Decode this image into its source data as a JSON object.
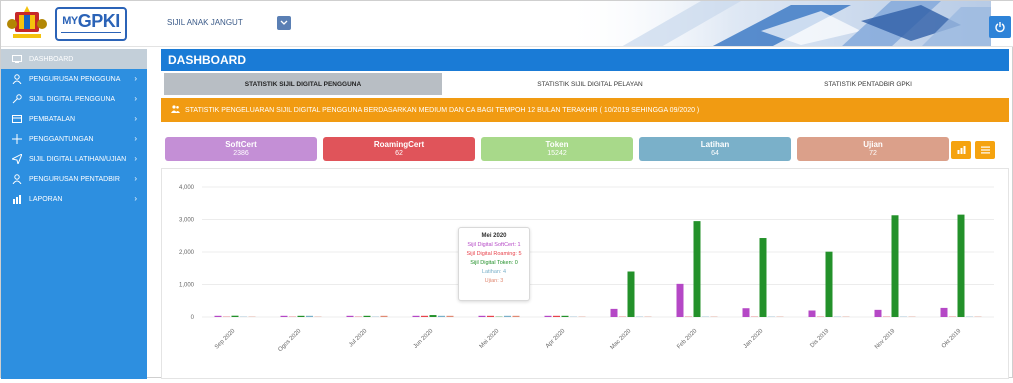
{
  "header": {
    "user_name": "SIJIL ANAK JANGUT",
    "logo_text_prefix": "MY",
    "logo_text_main": "GPKI",
    "dropdown_icon": "chevron-down-icon",
    "power_icon": "power-icon"
  },
  "sidebar": {
    "items": [
      {
        "label": "DASHBOARD",
        "icon": "monitor-icon",
        "active": true,
        "arrow": false
      },
      {
        "label": "PENGURUSAN PENGGUNA",
        "icon": "user-icon",
        "active": false,
        "arrow": true
      },
      {
        "label": "SIJIL DIGITAL PENGGUNA",
        "icon": "key-icon",
        "active": false,
        "arrow": true
      },
      {
        "label": "PEMBATALAN",
        "icon": "card-icon",
        "active": false,
        "arrow": true
      },
      {
        "label": "PENGGANTUNGAN",
        "icon": "arrows-icon",
        "active": false,
        "arrow": true
      },
      {
        "label": "SIJIL DIGITAL LATIHAN/UJIAN",
        "icon": "send-icon",
        "active": false,
        "arrow": true
      },
      {
        "label": "PENGURUSAN PENTADBIR",
        "icon": "user-icon",
        "active": false,
        "arrow": true
      },
      {
        "label": "LAPORAN",
        "icon": "chart-icon",
        "active": false,
        "arrow": true
      }
    ],
    "arrow_glyph": "›"
  },
  "main": {
    "title": "DASHBOARD",
    "tabs": [
      {
        "label": "STATISTIK SIJIL DIGITAL PENGGUNA",
        "active": true
      },
      {
        "label": "STATISTIK SIJIL DIGITAL PELAYAN",
        "active": false
      },
      {
        "label": "STATISTIK PENTADBIR GPKI",
        "active": false
      }
    ],
    "info_text": "STATISTIK PENGELUARAN SIJIL DIGITAL PENGGUNA BERDASARKAN MEDIUM DAN CA BAGI TEMPOH 12 BULAN TERAKHIR ( 10/2019 SEHINGGA 09/2020 )"
  },
  "cards": [
    {
      "label": "SoftCert",
      "value": "2386",
      "color": "#c48fd6"
    },
    {
      "label": "RoamingCert",
      "value": "62",
      "color": "#e0545a"
    },
    {
      "label": "Token",
      "value": "15242",
      "color": "#a8d98a"
    },
    {
      "label": "Latihan",
      "value": "64",
      "color": "#7ab0c9"
    },
    {
      "label": "Ujian",
      "value": "72",
      "color": "#dba08a"
    }
  ],
  "toolbar": {
    "chart_icon": "bar-chart-icon",
    "menu_icon": "menu-icon"
  },
  "colors": {
    "softcert": "#b548c6",
    "roaming": "#e8434c",
    "token": "#23912a",
    "latihan": "#7ab0c9",
    "ujian": "#e08a74",
    "accent": "#1a7bd6",
    "orange": "#f19b12"
  },
  "chart_data": {
    "type": "bar",
    "categories": [
      "Sep 2020",
      "Ogos 2020",
      "Jul 2020",
      "Jun 2020",
      "Mei 2020",
      "Apr 2020",
      "Mac 2020",
      "Feb 2020",
      "Jan 2020",
      "Dis 2019",
      "Nov 2019",
      "Okt 2019"
    ],
    "series": [
      {
        "name": "Sijil Digital SoftCert",
        "values": [
          2,
          10,
          12,
          30,
          1,
          25,
          250,
          1020,
          270,
          200,
          220,
          280
        ]
      },
      {
        "name": "Sijil Digital Roaming",
        "values": [
          0,
          0,
          0,
          15,
          5,
          5,
          0,
          0,
          0,
          0,
          0,
          0
        ]
      },
      {
        "name": "Sijil Digital Token",
        "values": [
          40,
          15,
          10,
          60,
          0,
          10,
          1400,
          2950,
          2430,
          2010,
          3130,
          3150
        ]
      },
      {
        "name": "Latihan",
        "values": [
          0,
          2,
          0,
          10,
          4,
          0,
          0,
          0,
          0,
          0,
          0,
          0
        ]
      },
      {
        "name": "Ujian",
        "values": [
          0,
          0,
          2,
          8,
          3,
          0,
          0,
          0,
          0,
          0,
          0,
          0
        ]
      }
    ],
    "yticks": [
      "0",
      "1,000",
      "2,000",
      "3,000",
      "4,000"
    ],
    "ylim": [
      0,
      4000
    ],
    "tooltip": {
      "title": "Mei 2020",
      "lines": [
        {
          "text": "Sijil Digital SoftCert: 1",
          "color": "#b548c6"
        },
        {
          "text": "Sijil Digital Roaming: 5",
          "color": "#e8434c"
        },
        {
          "text": "Sijil Digital Token: 0",
          "color": "#23912a"
        },
        {
          "text": "Latihan: 4",
          "color": "#7ab0c9"
        },
        {
          "text": "Ujian: 3",
          "color": "#e08a74"
        }
      ]
    }
  }
}
